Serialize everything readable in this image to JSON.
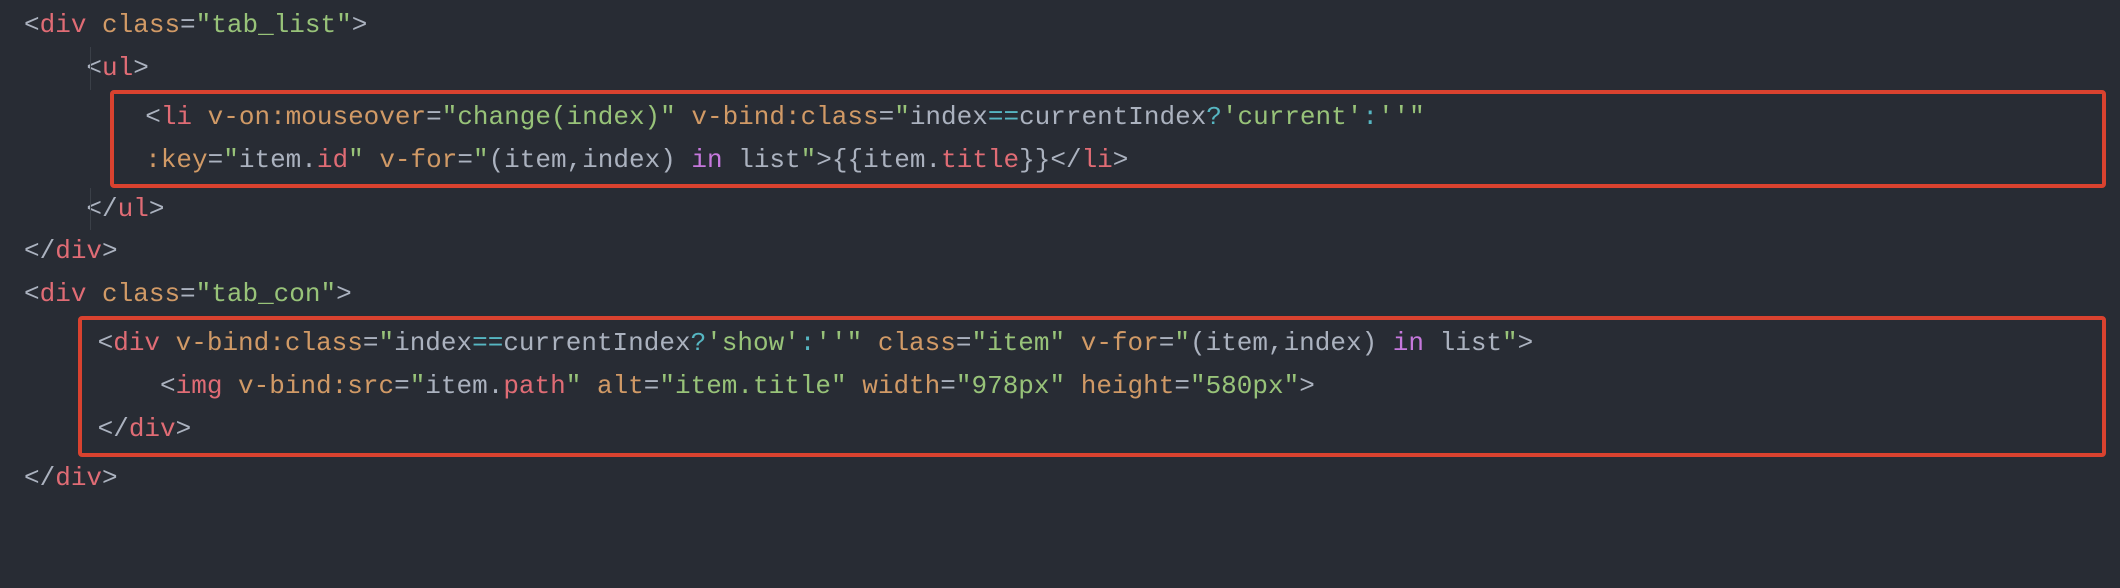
{
  "lines": {
    "l1": {
      "p1": "<",
      "tag": "div",
      "sp": " ",
      "attr": "class",
      "eq": "=",
      "q1": "\"",
      "val": "tab_list",
      "q2": "\"",
      "p2": ">"
    },
    "l2": {
      "pad": "    ",
      "p1": "<",
      "tag": "ul",
      "p2": ">"
    },
    "l3": {
      "pad": "        ",
      "p1": "<",
      "tag": "li",
      "sp1": " ",
      "a1": "v-on:mouseover",
      "eq1": "=",
      "v1q1": "\"",
      "v1": "change(index)",
      "v1q2": "\"",
      "sp2": " ",
      "a2": "v-bind:class",
      "eq2": "=",
      "v2q1": "\"",
      "v2a": "index",
      "v2op1": "==",
      "v2b": "currentIndex",
      "v2op2": "?",
      "v2c": "'current'",
      "v2op3": ":",
      "v2d": "''",
      "v2q2": "\""
    },
    "l4": {
      "pad": "        ",
      "a1": ":key",
      "eq1": "=",
      "v1q1": "\"",
      "v1a": "item",
      "v1dot": ".",
      "v1b": "id",
      "v1q2": "\"",
      "sp2": " ",
      "a2": "v-for",
      "eq2": "=",
      "v2q1": "\"",
      "v2a": "(item,index) ",
      "v2kw": "in",
      "v2b": " list",
      "v2q2": "\"",
      "p1": ">",
      "m1": "{{",
      "mexpA": "item",
      "mdot": ".",
      "mexpB": "title",
      "m2": "}}",
      "p2": "</",
      "tag": "li",
      "p3": ">"
    },
    "l5": {
      "pad": "    ",
      "p1": "</",
      "tag": "ul",
      "p2": ">"
    },
    "l6": {
      "p1": "</",
      "tag": "div",
      "p2": ">"
    },
    "l7": {
      "p1": "<",
      "tag": "div",
      "sp": " ",
      "attr": "class",
      "eq": "=",
      "q1": "\"",
      "val": "tab_con",
      "q2": "\"",
      "p2": ">"
    },
    "l8": {
      "pad": "    ",
      "p1": "<",
      "tag": "div",
      "sp1": " ",
      "a1": "v-bind:class",
      "eq1": "=",
      "v1q1": "\"",
      "v1a": "index",
      "v1op1": "==",
      "v1b": "currentIndex",
      "v1op2": "?",
      "v1c": "'show'",
      "v1op3": ":",
      "v1d": "''",
      "v1q2": "\"",
      "sp2": " ",
      "a2": "class",
      "eq2": "=",
      "v2q1": "\"",
      "v2": "item",
      "v2q2": "\"",
      "sp3": " ",
      "a3": "v-for",
      "eq3": "=",
      "v3q1": "\"",
      "v3a": "(item,index) ",
      "v3kw": "in",
      "v3b": " list",
      "v3q2": "\"",
      "p2": ">"
    },
    "l9": {
      "pad": "        ",
      "p1": "<",
      "tag": "img",
      "sp1": " ",
      "a1": "v-bind:src",
      "eq1": "=",
      "v1q1": "\"",
      "v1a": "item",
      "v1dot": ".",
      "v1b": "path",
      "v1q2": "\"",
      "sp2": " ",
      "a2": "alt",
      "eq2": "=",
      "v2q1": "\"",
      "v2": "item.title",
      "v2q2": "\"",
      "sp3": " ",
      "a3": "width",
      "eq3": "=",
      "v3q1": "\"",
      "v3": "978px",
      "v3q2": "\"",
      "sp4": " ",
      "a4": "height",
      "eq4": "=",
      "v4q1": "\"",
      "v4": "580px",
      "v4q2": "\"",
      "p2": ">"
    },
    "l10": {
      "pad": "    ",
      "p1": "</",
      "tag": "div",
      "p2": ">"
    },
    "l11": {
      "p1": "</",
      "tag": "div",
      "p2": ">"
    }
  },
  "colors": {
    "highlight_border": "#d9422f",
    "background": "#282c34"
  }
}
